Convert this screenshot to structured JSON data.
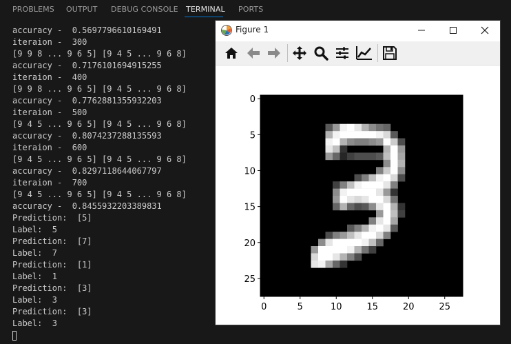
{
  "panel": {
    "tabs": [
      {
        "label": "PROBLEMS"
      },
      {
        "label": "OUTPUT"
      },
      {
        "label": "DEBUG CONSOLE"
      },
      {
        "label": "TERMINAL",
        "active": true
      },
      {
        "label": "PORTS"
      }
    ]
  },
  "terminal": {
    "lines": [
      "accuracy -  0.5697796610169491",
      "iteraion -  300",
      "[9 9 8 ... 9 6 5] [9 4 5 ... 9 6 8]",
      "accuracy -  0.7176101694915255",
      "iteraion -  400",
      "[9 9 8 ... 9 6 5] [9 4 5 ... 9 6 8]",
      "accuracy -  0.7762881355932203",
      "iteraion -  500",
      "[9 4 5 ... 9 6 5] [9 4 5 ... 9 6 8]",
      "accuracy -  0.8074237288135593",
      "iteraion -  600",
      "[9 4 5 ... 9 6 5] [9 4 5 ... 9 6 8]",
      "accuracy -  0.8297118644067797",
      "iteraion -  700",
      "[9 4 5 ... 9 6 5] [9 4 5 ... 9 6 8]",
      "accuracy -  0.8455932203389831",
      "Prediction:  [5]",
      "Label:  5",
      "Prediction:  [7]",
      "Label:  7",
      "Prediction:  [1]",
      "Label:  1",
      "Prediction:  [3]",
      "Label:  3",
      "Prediction:  [3]",
      "Label:  3"
    ]
  },
  "figure": {
    "title": "Figure 1",
    "toolbar_icons": [
      "home-icon",
      "back-arrow-icon",
      "forward-arrow-icon",
      "pan-icon",
      "zoom-icon",
      "subplots-icon",
      "customize-icon",
      "save-icon"
    ],
    "window_icons": [
      "minimize-icon",
      "maximize-icon",
      "close-icon"
    ]
  },
  "colors": {
    "terminal_bg": "#181818",
    "terminal_text": "#cccccc",
    "tab_active_underline": "#0078d4"
  },
  "chart_data": {
    "type": "heatmap",
    "colormap": "gray",
    "x_ticks": [
      "0",
      "5",
      "10",
      "15",
      "20",
      "25"
    ],
    "y_ticks": [
      "0",
      "5",
      "10",
      "15",
      "20",
      "25"
    ],
    "xlim": [
      -0.5,
      27.5
    ],
    "ylim": [
      27.5,
      -0.5
    ],
    "grid": false,
    "pixels": [
      {
        "r": 4,
        "c": 9,
        "v": 0.35
      },
      {
        "r": 4,
        "c": 10,
        "v": 0.6
      },
      {
        "r": 4,
        "c": 11,
        "v": 0.95
      },
      {
        "r": 4,
        "c": 12,
        "v": 1.0
      },
      {
        "r": 4,
        "c": 13,
        "v": 0.9
      },
      {
        "r": 4,
        "c": 14,
        "v": 0.7
      },
      {
        "r": 4,
        "c": 15,
        "v": 0.55
      },
      {
        "r": 4,
        "c": 16,
        "v": 0.45
      },
      {
        "r": 4,
        "c": 17,
        "v": 0.4
      },
      {
        "r": 5,
        "c": 9,
        "v": 0.7
      },
      {
        "r": 5,
        "c": 10,
        "v": 0.95
      },
      {
        "r": 5,
        "c": 11,
        "v": 1.0
      },
      {
        "r": 5,
        "c": 12,
        "v": 1.0
      },
      {
        "r": 5,
        "c": 13,
        "v": 1.0
      },
      {
        "r": 5,
        "c": 14,
        "v": 1.0
      },
      {
        "r": 5,
        "c": 15,
        "v": 1.0
      },
      {
        "r": 5,
        "c": 16,
        "v": 0.95
      },
      {
        "r": 5,
        "c": 17,
        "v": 0.85
      },
      {
        "r": 5,
        "c": 18,
        "v": 0.35
      },
      {
        "r": 6,
        "c": 9,
        "v": 0.95
      },
      {
        "r": 6,
        "c": 10,
        "v": 1.0
      },
      {
        "r": 6,
        "c": 11,
        "v": 0.7
      },
      {
        "r": 6,
        "c": 12,
        "v": 0.55
      },
      {
        "r": 6,
        "c": 13,
        "v": 0.5
      },
      {
        "r": 6,
        "c": 14,
        "v": 0.5
      },
      {
        "r": 6,
        "c": 15,
        "v": 0.55
      },
      {
        "r": 6,
        "c": 16,
        "v": 0.6
      },
      {
        "r": 6,
        "c": 17,
        "v": 1.0
      },
      {
        "r": 6,
        "c": 18,
        "v": 0.8
      },
      {
        "r": 6,
        "c": 19,
        "v": 0.3
      },
      {
        "r": 7,
        "c": 9,
        "v": 0.9
      },
      {
        "r": 7,
        "c": 10,
        "v": 0.75
      },
      {
        "r": 7,
        "c": 11,
        "v": 0.2
      },
      {
        "r": 7,
        "c": 17,
        "v": 0.7
      },
      {
        "r": 7,
        "c": 18,
        "v": 1.0
      },
      {
        "r": 7,
        "c": 19,
        "v": 0.6
      },
      {
        "r": 8,
        "c": 9,
        "v": 0.6
      },
      {
        "r": 8,
        "c": 10,
        "v": 0.4
      },
      {
        "r": 8,
        "c": 11,
        "v": 0.15
      },
      {
        "r": 8,
        "c": 12,
        "v": 0.25
      },
      {
        "r": 8,
        "c": 13,
        "v": 0.3
      },
      {
        "r": 8,
        "c": 14,
        "v": 0.3
      },
      {
        "r": 8,
        "c": 15,
        "v": 0.3
      },
      {
        "r": 8,
        "c": 16,
        "v": 0.35
      },
      {
        "r": 8,
        "c": 17,
        "v": 0.75
      },
      {
        "r": 8,
        "c": 18,
        "v": 1.0
      },
      {
        "r": 8,
        "c": 19,
        "v": 0.65
      },
      {
        "r": 9,
        "c": 17,
        "v": 0.55
      },
      {
        "r": 9,
        "c": 18,
        "v": 1.0
      },
      {
        "r": 9,
        "c": 19,
        "v": 0.7
      },
      {
        "r": 10,
        "c": 16,
        "v": 0.5
      },
      {
        "r": 10,
        "c": 17,
        "v": 0.8
      },
      {
        "r": 10,
        "c": 18,
        "v": 1.0
      },
      {
        "r": 10,
        "c": 19,
        "v": 0.55
      },
      {
        "r": 11,
        "c": 13,
        "v": 0.3
      },
      {
        "r": 11,
        "c": 14,
        "v": 0.5
      },
      {
        "r": 11,
        "c": 15,
        "v": 0.75
      },
      {
        "r": 11,
        "c": 16,
        "v": 0.95
      },
      {
        "r": 11,
        "c": 17,
        "v": 1.0
      },
      {
        "r": 11,
        "c": 18,
        "v": 0.85
      },
      {
        "r": 11,
        "c": 19,
        "v": 0.3
      },
      {
        "r": 12,
        "c": 10,
        "v": 0.25
      },
      {
        "r": 12,
        "c": 11,
        "v": 0.5
      },
      {
        "r": 12,
        "c": 12,
        "v": 0.75
      },
      {
        "r": 12,
        "c": 13,
        "v": 0.95
      },
      {
        "r": 12,
        "c": 14,
        "v": 1.0
      },
      {
        "r": 12,
        "c": 15,
        "v": 1.0
      },
      {
        "r": 12,
        "c": 16,
        "v": 1.0
      },
      {
        "r": 12,
        "c": 17,
        "v": 0.9
      },
      {
        "r": 12,
        "c": 18,
        "v": 0.5
      },
      {
        "r": 13,
        "c": 10,
        "v": 0.55
      },
      {
        "r": 13,
        "c": 11,
        "v": 0.95
      },
      {
        "r": 13,
        "c": 12,
        "v": 1.0
      },
      {
        "r": 13,
        "c": 13,
        "v": 1.0
      },
      {
        "r": 13,
        "c": 14,
        "v": 1.0
      },
      {
        "r": 13,
        "c": 15,
        "v": 1.0
      },
      {
        "r": 13,
        "c": 16,
        "v": 0.9
      },
      {
        "r": 13,
        "c": 17,
        "v": 0.6
      },
      {
        "r": 13,
        "c": 18,
        "v": 0.2
      },
      {
        "r": 14,
        "c": 10,
        "v": 0.6
      },
      {
        "r": 14,
        "c": 11,
        "v": 1.0
      },
      {
        "r": 14,
        "c": 12,
        "v": 0.9
      },
      {
        "r": 14,
        "c": 13,
        "v": 0.85
      },
      {
        "r": 14,
        "c": 14,
        "v": 0.9
      },
      {
        "r": 14,
        "c": 15,
        "v": 1.0
      },
      {
        "r": 14,
        "c": 16,
        "v": 1.0
      },
      {
        "r": 14,
        "c": 17,
        "v": 0.85
      },
      {
        "r": 14,
        "c": 18,
        "v": 0.45
      },
      {
        "r": 15,
        "c": 10,
        "v": 0.4
      },
      {
        "r": 15,
        "c": 11,
        "v": 0.7
      },
      {
        "r": 15,
        "c": 12,
        "v": 0.4
      },
      {
        "r": 15,
        "c": 13,
        "v": 0.3
      },
      {
        "r": 15,
        "c": 14,
        "v": 0.35
      },
      {
        "r": 15,
        "c": 15,
        "v": 0.55
      },
      {
        "r": 15,
        "c": 16,
        "v": 0.9
      },
      {
        "r": 15,
        "c": 17,
        "v": 1.0
      },
      {
        "r": 15,
        "c": 18,
        "v": 0.7
      },
      {
        "r": 15,
        "c": 19,
        "v": 0.2
      },
      {
        "r": 16,
        "c": 16,
        "v": 0.6
      },
      {
        "r": 16,
        "c": 17,
        "v": 1.0
      },
      {
        "r": 16,
        "c": 18,
        "v": 0.75
      },
      {
        "r": 16,
        "c": 19,
        "v": 0.25
      },
      {
        "r": 17,
        "c": 15,
        "v": 0.5
      },
      {
        "r": 17,
        "c": 16,
        "v": 0.9
      },
      {
        "r": 17,
        "c": 17,
        "v": 1.0
      },
      {
        "r": 17,
        "c": 18,
        "v": 0.65
      },
      {
        "r": 18,
        "c": 12,
        "v": 0.35
      },
      {
        "r": 18,
        "c": 13,
        "v": 0.5
      },
      {
        "r": 18,
        "c": 14,
        "v": 0.7
      },
      {
        "r": 18,
        "c": 15,
        "v": 0.95
      },
      {
        "r": 18,
        "c": 16,
        "v": 1.0
      },
      {
        "r": 18,
        "c": 17,
        "v": 0.9
      },
      {
        "r": 18,
        "c": 18,
        "v": 0.35
      },
      {
        "r": 19,
        "c": 9,
        "v": 0.3
      },
      {
        "r": 19,
        "c": 10,
        "v": 0.5
      },
      {
        "r": 19,
        "c": 11,
        "v": 0.6
      },
      {
        "r": 19,
        "c": 12,
        "v": 0.75
      },
      {
        "r": 19,
        "c": 13,
        "v": 0.9
      },
      {
        "r": 19,
        "c": 14,
        "v": 1.0
      },
      {
        "r": 19,
        "c": 15,
        "v": 1.0
      },
      {
        "r": 19,
        "c": 16,
        "v": 0.85
      },
      {
        "r": 19,
        "c": 17,
        "v": 0.5
      },
      {
        "r": 20,
        "c": 8,
        "v": 0.55
      },
      {
        "r": 20,
        "c": 9,
        "v": 0.9
      },
      {
        "r": 20,
        "c": 10,
        "v": 1.0
      },
      {
        "r": 20,
        "c": 11,
        "v": 1.0
      },
      {
        "r": 20,
        "c": 12,
        "v": 1.0
      },
      {
        "r": 20,
        "c": 13,
        "v": 1.0
      },
      {
        "r": 20,
        "c": 14,
        "v": 0.95
      },
      {
        "r": 20,
        "c": 15,
        "v": 0.75
      },
      {
        "r": 20,
        "c": 16,
        "v": 0.4
      },
      {
        "r": 21,
        "c": 7,
        "v": 0.6
      },
      {
        "r": 21,
        "c": 8,
        "v": 1.0
      },
      {
        "r": 21,
        "c": 9,
        "v": 1.0
      },
      {
        "r": 21,
        "c": 10,
        "v": 1.0
      },
      {
        "r": 21,
        "c": 11,
        "v": 1.0
      },
      {
        "r": 21,
        "c": 12,
        "v": 0.95
      },
      {
        "r": 21,
        "c": 13,
        "v": 0.7
      },
      {
        "r": 21,
        "c": 14,
        "v": 0.45
      },
      {
        "r": 21,
        "c": 15,
        "v": 0.25
      },
      {
        "r": 22,
        "c": 7,
        "v": 0.85
      },
      {
        "r": 22,
        "c": 8,
        "v": 1.0
      },
      {
        "r": 22,
        "c": 9,
        "v": 1.0
      },
      {
        "r": 22,
        "c": 10,
        "v": 0.9
      },
      {
        "r": 22,
        "c": 11,
        "v": 0.7
      },
      {
        "r": 22,
        "c": 12,
        "v": 0.5
      },
      {
        "r": 22,
        "c": 13,
        "v": 0.3
      },
      {
        "r": 23,
        "c": 7,
        "v": 0.9
      },
      {
        "r": 23,
        "c": 8,
        "v": 0.95
      },
      {
        "r": 23,
        "c": 9,
        "v": 0.65
      },
      {
        "r": 23,
        "c": 10,
        "v": 0.4
      },
      {
        "r": 23,
        "c": 11,
        "v": 0.2
      }
    ]
  }
}
